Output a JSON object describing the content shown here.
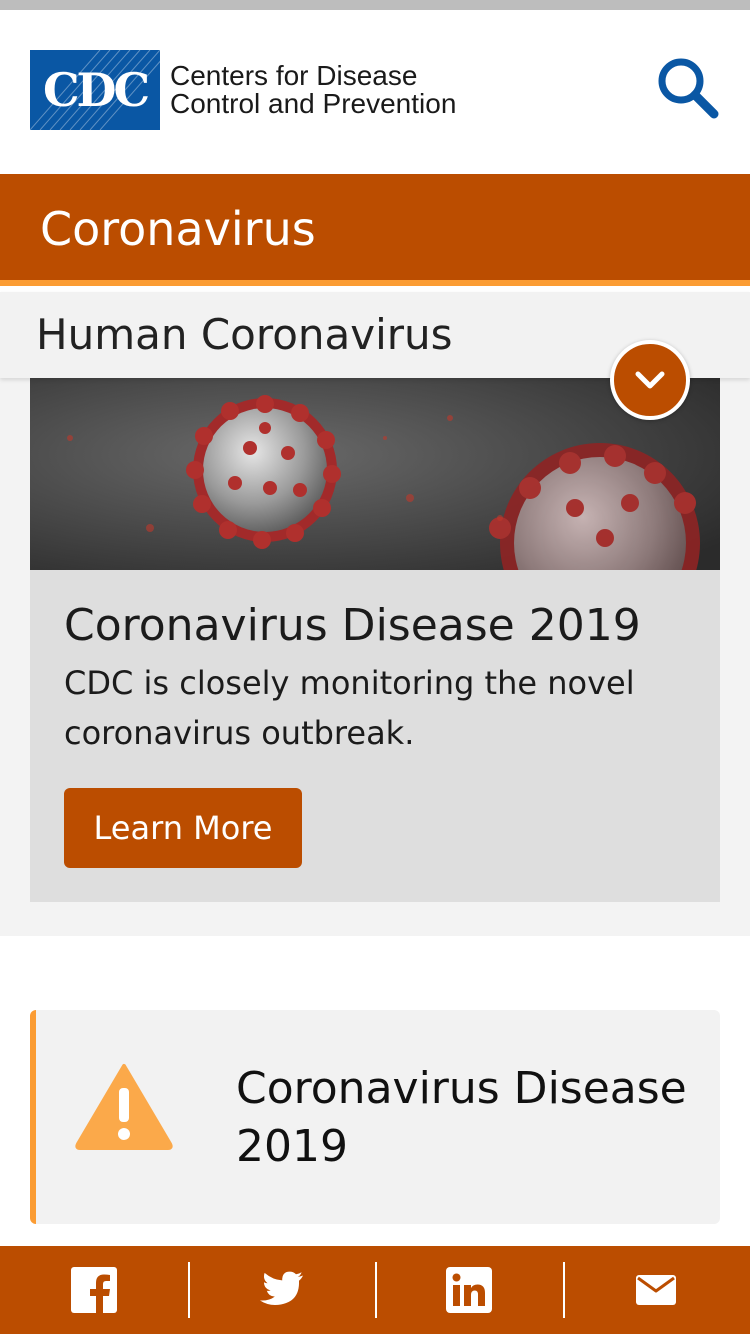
{
  "header": {
    "logo_mark": "CDC",
    "logo_line1": "Centers for Disease",
    "logo_line2": "Control and Prevention",
    "search_icon": "search-icon"
  },
  "section": {
    "title": "Coronavirus"
  },
  "subnav": {
    "title": "Human Coronavirus",
    "toggle_icon": "chevron-down-icon"
  },
  "feature": {
    "image": "coronavirus-illustration",
    "title": "Coronavirus Disease 2019",
    "description": "CDC is closely monitoring the novel coronavirus outbreak.",
    "button_label": "Learn More"
  },
  "alert": {
    "icon": "warning-icon",
    "text": "Coronavirus Disease 2019"
  },
  "share": {
    "items": [
      {
        "icon": "facebook-icon"
      },
      {
        "icon": "twitter-icon"
      },
      {
        "icon": "linkedin-icon"
      },
      {
        "icon": "email-icon"
      }
    ]
  },
  "colors": {
    "brand_orange": "#bb4d00",
    "accent_orange": "#fb9c33",
    "cdc_blue": "#0a57a4",
    "card_gray": "#dedede",
    "panel_gray": "#f2f2f2"
  }
}
